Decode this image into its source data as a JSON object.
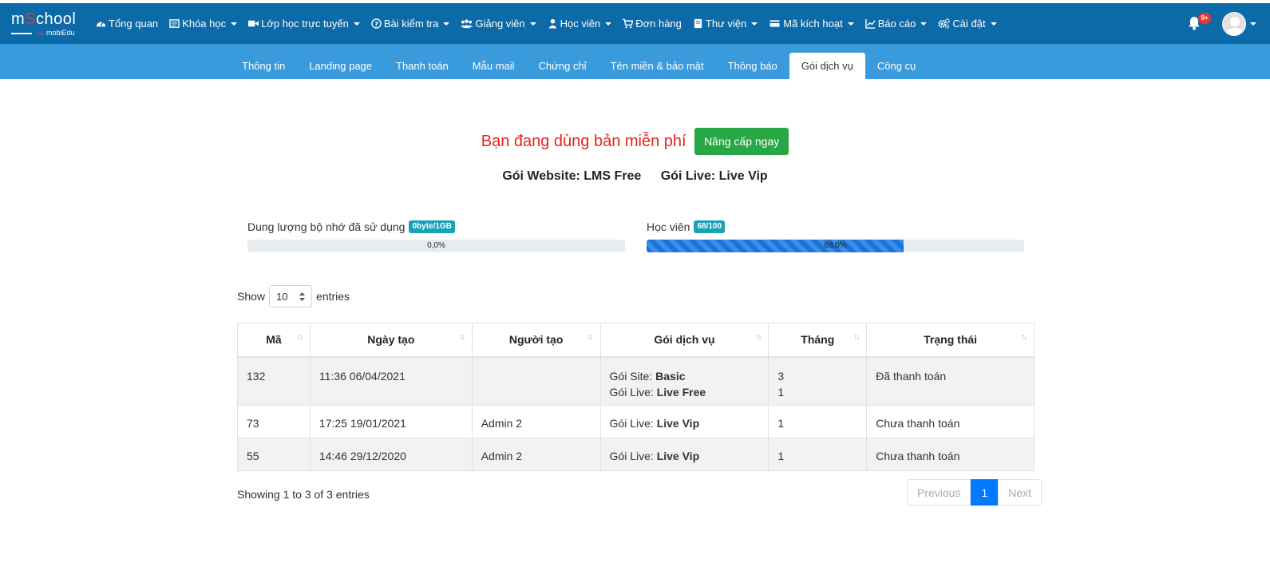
{
  "brand": {
    "logo_main": "mSchool",
    "logo_sub": "mobiEdu"
  },
  "nav": {
    "items": [
      {
        "label": "Tổng quan",
        "icon": "dashboard-icon",
        "dropdown": false
      },
      {
        "label": "Khóa học",
        "icon": "book-icon",
        "dropdown": true
      },
      {
        "label": "Lớp học trực tuyến",
        "icon": "video-icon",
        "dropdown": true
      },
      {
        "label": "Bài kiểm tra",
        "icon": "question-circle-icon",
        "dropdown": true
      },
      {
        "label": "Giảng viên",
        "icon": "users-icon",
        "dropdown": true
      },
      {
        "label": "Học viên",
        "icon": "user-icon",
        "dropdown": true
      },
      {
        "label": "Đơn hàng",
        "icon": "cart-icon",
        "dropdown": false
      },
      {
        "label": "Thư viện",
        "icon": "library-icon",
        "dropdown": true
      },
      {
        "label": "Mã kích hoạt",
        "icon": "card-icon",
        "dropdown": true
      },
      {
        "label": "Báo cáo",
        "icon": "chart-icon",
        "dropdown": true
      },
      {
        "label": "Cài đặt",
        "icon": "gears-icon",
        "dropdown": true
      }
    ],
    "notification_badge": "9+"
  },
  "subnav": {
    "tabs": [
      "Thông tin",
      "Landing page",
      "Thanh toán",
      "Mẫu mail",
      "Chứng chỉ",
      "Tên miền & bảo mật",
      "Thông báo",
      "Gói dịch vụ",
      "Công cụ"
    ],
    "active": "Gói dịch vụ"
  },
  "plan": {
    "status_text": "Bạn đang dùng bản miễn phí",
    "upgrade_button": "Nâng cấp ngay",
    "website_plan": "Gói Website: LMS Free",
    "live_plan": "Gói Live: Live Vip"
  },
  "usage": {
    "storage": {
      "label": "Dung lượng bộ nhớ đã sử dụng",
      "badge": "0byte/1GB",
      "percent_text": "0,0%",
      "fraction": 0.0
    },
    "students": {
      "label": "Học viên",
      "badge": "68/100",
      "percent_text": "68,0%",
      "fraction": 0.68
    }
  },
  "table": {
    "show_label": "Show",
    "entries_label": "entries",
    "page_size": "10",
    "columns": [
      "Mã",
      "Ngày tạo",
      "Người tạo",
      "Gói dịch vụ",
      "Tháng",
      "Trạng thái"
    ],
    "rows": [
      {
        "id": "132",
        "created": "11:36 06/04/2021",
        "creator": "",
        "packages": [
          {
            "prefix": "Gói Site: ",
            "name": "Basic"
          },
          {
            "prefix": "Gói Live: ",
            "name": "Live Free"
          }
        ],
        "months": [
          "3",
          "1"
        ],
        "status": "Đã thanh toán"
      },
      {
        "id": "73",
        "created": "17:25 19/01/2021",
        "creator": "Admin 2",
        "packages": [
          {
            "prefix": "Gói Live: ",
            "name": "Live Vip"
          }
        ],
        "months": [
          "1"
        ],
        "status": "Chưa thanh toán"
      },
      {
        "id": "55",
        "created": "14:46 29/12/2020",
        "creator": "Admin 2",
        "packages": [
          {
            "prefix": "Gói Live: ",
            "name": "Live Vip"
          }
        ],
        "months": [
          "1"
        ],
        "status": "Chưa thanh toán"
      }
    ],
    "info": "Showing 1 to 3 of 3 entries",
    "pager": {
      "previous": "Previous",
      "current": "1",
      "next": "Next"
    }
  }
}
